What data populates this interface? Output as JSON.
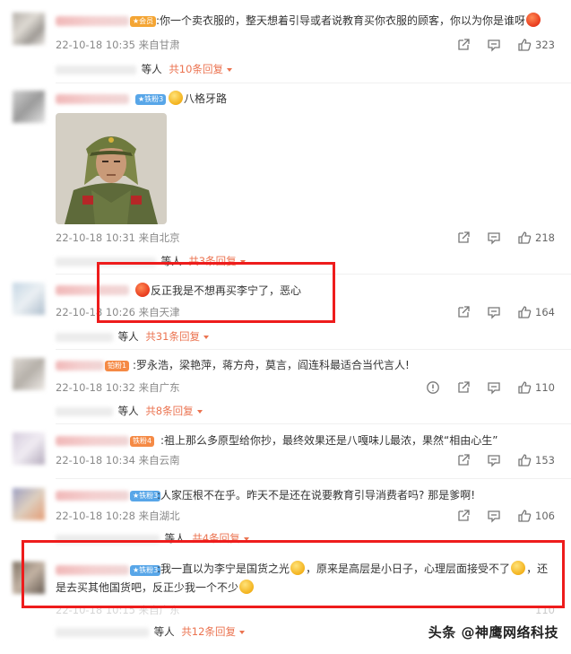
{
  "comments": [
    {
      "badge": "★会员",
      "text": ":你一个卖衣服的，整天想着引导或者说教育买你衣服的顾客，你以为你是谁呀",
      "meta": "22-10-18 10:35 来自甘肃",
      "likes": "323",
      "reply_who": "等人",
      "reply_link": "共10条回复"
    },
    {
      "badge": "★铁粉3",
      "text": "八格牙路",
      "meta": "22-10-18 10:31 来自北京",
      "likes": "218",
      "reply_who": "等人",
      "reply_link": "共3条回复"
    },
    {
      "badge": "",
      "text": "反正我是不想再买李宁了，恶心",
      "meta": "22-10-18 10:26 来自天津",
      "likes": "164",
      "reply_who": "等人",
      "reply_link": "共31条回复"
    },
    {
      "badge": "铂粉1",
      "text": ":罗永浩，梁艳萍，蒋方舟，莫言，阎连科最适合当代言人!",
      "meta": "22-10-18 10:32 来自广东",
      "likes": "110",
      "reply_who": "等人",
      "reply_link": "共8条回复"
    },
    {
      "badge": "铁粉4",
      "text": ":祖上那么多原型给你抄，最终效果还是八嘎味儿最浓，果然“相由心生”",
      "meta": "22-10-18 10:34 来自云南",
      "likes": "153"
    },
    {
      "badge": "★铁粉3",
      "text": ":人家压根不在乎。昨天不是还在说要教育引导消费者吗? 那是爹啊!",
      "meta": "22-10-18 10:28 来自湖北",
      "likes": "106",
      "reply_who": "等人",
      "reply_link": "共4条回复"
    },
    {
      "badge": "★铁粉3",
      "text_line1": ":我一直以为李宁是国货之光",
      "text_line1b": "，原来是高层是小日子，心理层面接受不了",
      "text_line1c": "，还",
      "text_line2": "是去买其他国货吧，反正少我一个不少",
      "meta": "22-10-18 10:15 来自广东",
      "likes": "110",
      "reply_who": "等人",
      "reply_link": "共12条回复"
    }
  ],
  "watermark": "头条 @神鹰网络科技",
  "colors": {
    "accent": "#eb7350",
    "highlight_box": "#ee1c1c",
    "meta_text": "#8a8a8a"
  },
  "icons": [
    "share-icon",
    "comment-icon",
    "like-icon",
    "report-icon"
  ]
}
